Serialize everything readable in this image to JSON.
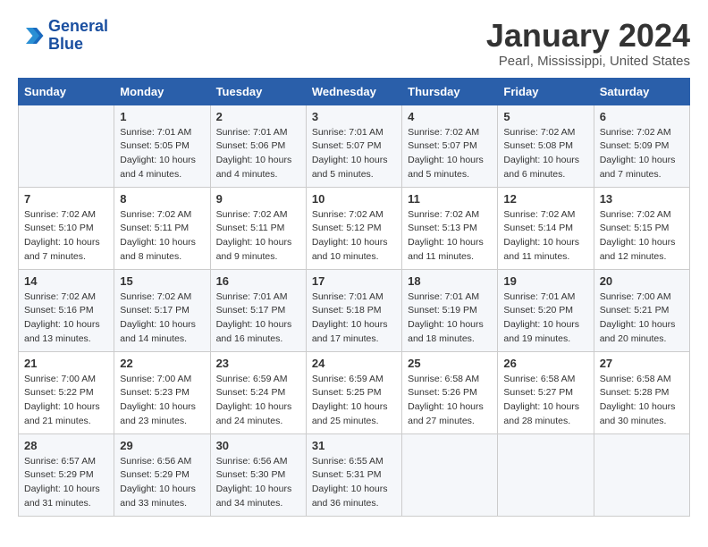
{
  "logo": {
    "line1": "General",
    "line2": "Blue"
  },
  "title": "January 2024",
  "location": "Pearl, Mississippi, United States",
  "headers": [
    "Sunday",
    "Monday",
    "Tuesday",
    "Wednesday",
    "Thursday",
    "Friday",
    "Saturday"
  ],
  "weeks": [
    [
      {
        "day": "",
        "info": ""
      },
      {
        "day": "1",
        "info": "Sunrise: 7:01 AM\nSunset: 5:05 PM\nDaylight: 10 hours\nand 4 minutes."
      },
      {
        "day": "2",
        "info": "Sunrise: 7:01 AM\nSunset: 5:06 PM\nDaylight: 10 hours\nand 4 minutes."
      },
      {
        "day": "3",
        "info": "Sunrise: 7:01 AM\nSunset: 5:07 PM\nDaylight: 10 hours\nand 5 minutes."
      },
      {
        "day": "4",
        "info": "Sunrise: 7:02 AM\nSunset: 5:07 PM\nDaylight: 10 hours\nand 5 minutes."
      },
      {
        "day": "5",
        "info": "Sunrise: 7:02 AM\nSunset: 5:08 PM\nDaylight: 10 hours\nand 6 minutes."
      },
      {
        "day": "6",
        "info": "Sunrise: 7:02 AM\nSunset: 5:09 PM\nDaylight: 10 hours\nand 7 minutes."
      }
    ],
    [
      {
        "day": "7",
        "info": "Sunrise: 7:02 AM\nSunset: 5:10 PM\nDaylight: 10 hours\nand 7 minutes."
      },
      {
        "day": "8",
        "info": "Sunrise: 7:02 AM\nSunset: 5:11 PM\nDaylight: 10 hours\nand 8 minutes."
      },
      {
        "day": "9",
        "info": "Sunrise: 7:02 AM\nSunset: 5:11 PM\nDaylight: 10 hours\nand 9 minutes."
      },
      {
        "day": "10",
        "info": "Sunrise: 7:02 AM\nSunset: 5:12 PM\nDaylight: 10 hours\nand 10 minutes."
      },
      {
        "day": "11",
        "info": "Sunrise: 7:02 AM\nSunset: 5:13 PM\nDaylight: 10 hours\nand 11 minutes."
      },
      {
        "day": "12",
        "info": "Sunrise: 7:02 AM\nSunset: 5:14 PM\nDaylight: 10 hours\nand 11 minutes."
      },
      {
        "day": "13",
        "info": "Sunrise: 7:02 AM\nSunset: 5:15 PM\nDaylight: 10 hours\nand 12 minutes."
      }
    ],
    [
      {
        "day": "14",
        "info": "Sunrise: 7:02 AM\nSunset: 5:16 PM\nDaylight: 10 hours\nand 13 minutes."
      },
      {
        "day": "15",
        "info": "Sunrise: 7:02 AM\nSunset: 5:17 PM\nDaylight: 10 hours\nand 14 minutes."
      },
      {
        "day": "16",
        "info": "Sunrise: 7:01 AM\nSunset: 5:17 PM\nDaylight: 10 hours\nand 16 minutes."
      },
      {
        "day": "17",
        "info": "Sunrise: 7:01 AM\nSunset: 5:18 PM\nDaylight: 10 hours\nand 17 minutes."
      },
      {
        "day": "18",
        "info": "Sunrise: 7:01 AM\nSunset: 5:19 PM\nDaylight: 10 hours\nand 18 minutes."
      },
      {
        "day": "19",
        "info": "Sunrise: 7:01 AM\nSunset: 5:20 PM\nDaylight: 10 hours\nand 19 minutes."
      },
      {
        "day": "20",
        "info": "Sunrise: 7:00 AM\nSunset: 5:21 PM\nDaylight: 10 hours\nand 20 minutes."
      }
    ],
    [
      {
        "day": "21",
        "info": "Sunrise: 7:00 AM\nSunset: 5:22 PM\nDaylight: 10 hours\nand 21 minutes."
      },
      {
        "day": "22",
        "info": "Sunrise: 7:00 AM\nSunset: 5:23 PM\nDaylight: 10 hours\nand 23 minutes."
      },
      {
        "day": "23",
        "info": "Sunrise: 6:59 AM\nSunset: 5:24 PM\nDaylight: 10 hours\nand 24 minutes."
      },
      {
        "day": "24",
        "info": "Sunrise: 6:59 AM\nSunset: 5:25 PM\nDaylight: 10 hours\nand 25 minutes."
      },
      {
        "day": "25",
        "info": "Sunrise: 6:58 AM\nSunset: 5:26 PM\nDaylight: 10 hours\nand 27 minutes."
      },
      {
        "day": "26",
        "info": "Sunrise: 6:58 AM\nSunset: 5:27 PM\nDaylight: 10 hours\nand 28 minutes."
      },
      {
        "day": "27",
        "info": "Sunrise: 6:58 AM\nSunset: 5:28 PM\nDaylight: 10 hours\nand 30 minutes."
      }
    ],
    [
      {
        "day": "28",
        "info": "Sunrise: 6:57 AM\nSunset: 5:29 PM\nDaylight: 10 hours\nand 31 minutes."
      },
      {
        "day": "29",
        "info": "Sunrise: 6:56 AM\nSunset: 5:29 PM\nDaylight: 10 hours\nand 33 minutes."
      },
      {
        "day": "30",
        "info": "Sunrise: 6:56 AM\nSunset: 5:30 PM\nDaylight: 10 hours\nand 34 minutes."
      },
      {
        "day": "31",
        "info": "Sunrise: 6:55 AM\nSunset: 5:31 PM\nDaylight: 10 hours\nand 36 minutes."
      },
      {
        "day": "",
        "info": ""
      },
      {
        "day": "",
        "info": ""
      },
      {
        "day": "",
        "info": ""
      }
    ]
  ]
}
